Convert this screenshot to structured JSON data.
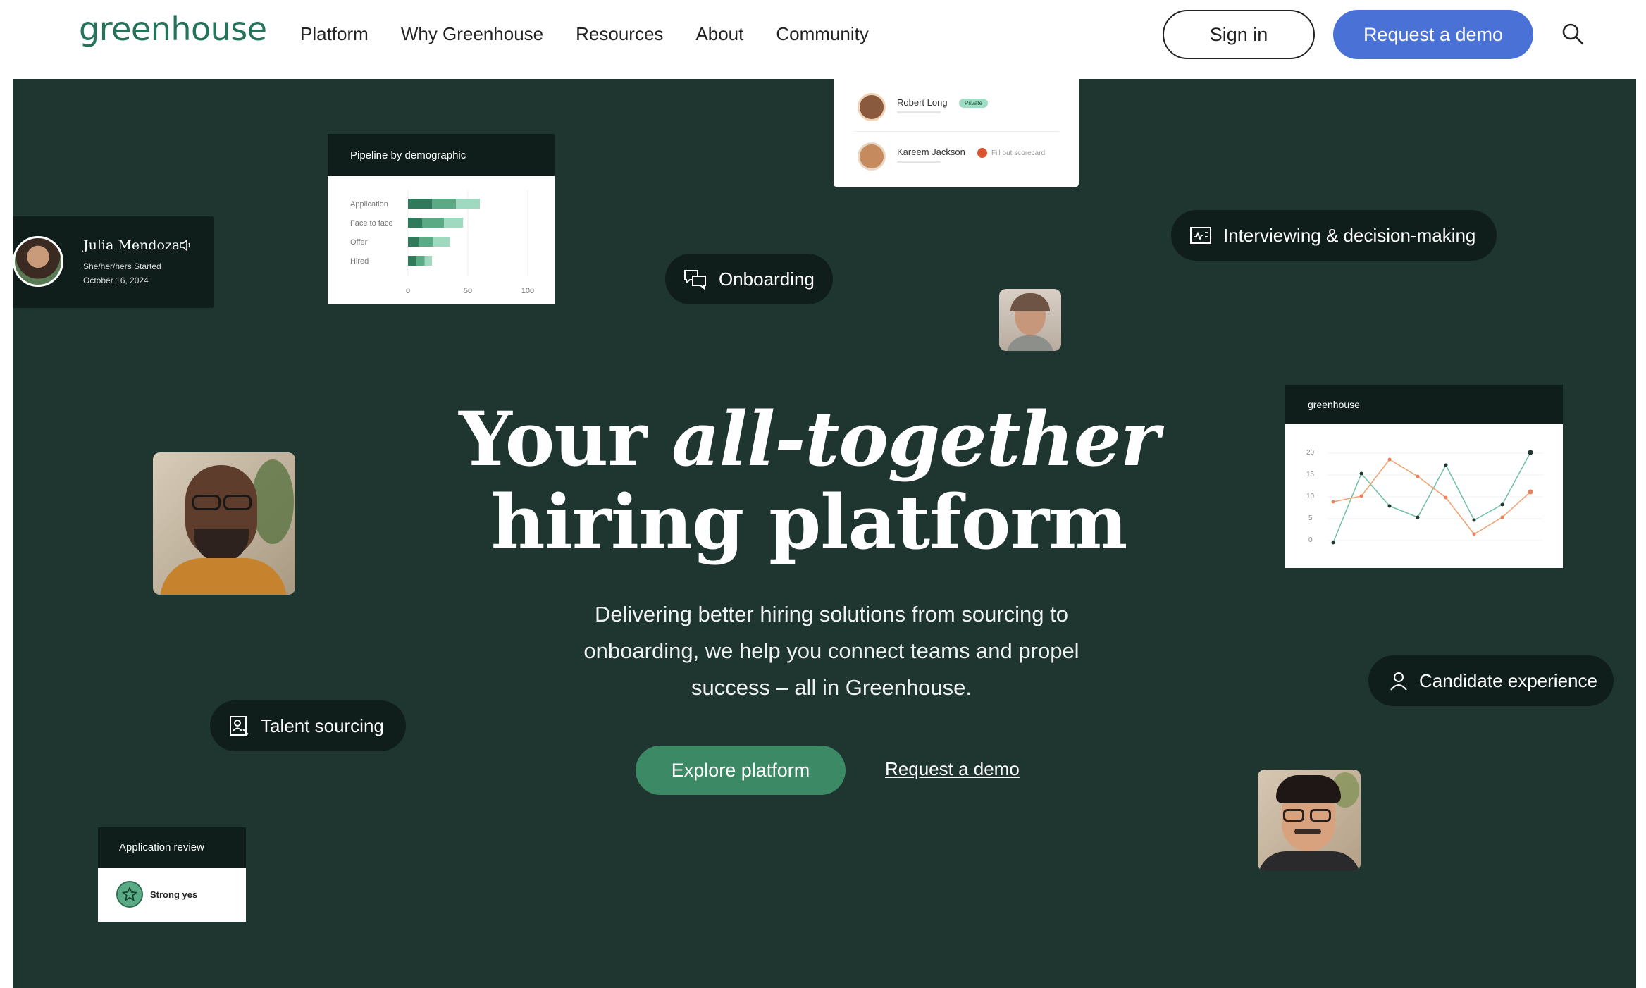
{
  "nav": {
    "logo": "greenhouse",
    "links": [
      "Platform",
      "Why Greenhouse",
      "Resources",
      "About",
      "Community"
    ],
    "signin": "Sign in",
    "request_demo": "Request a demo"
  },
  "hero": {
    "title_line1_plain": "Your ",
    "title_line1_italic": "all-together",
    "title_line2": "hiring platform",
    "subtitle": "Delivering better hiring solutions from sourcing to onboarding, we help you connect teams and propel success – all in Greenhouse.",
    "primary_cta": "Explore platform",
    "secondary_cta": "Request a demo"
  },
  "cards": {
    "profile": {
      "name": "Julia Mendoza",
      "pronouns_line": "She/her/hers  Started",
      "date_line": "October 16, 2024"
    },
    "pipeline": {
      "title": "Pipeline by demographic",
      "rows": [
        "Application",
        "Face to face",
        "Offer",
        "Hired"
      ],
      "ticks": [
        "0",
        "50",
        "100"
      ],
      "bars": [
        [
          20,
          20,
          20
        ],
        [
          12,
          18,
          16
        ],
        [
          9,
          12,
          14
        ],
        [
          7,
          7,
          6
        ]
      ]
    },
    "interviewers": [
      {
        "name": "Robert Long",
        "badge": "Private"
      },
      {
        "name": "Kareem Jackson",
        "status": "Fill out scorecard"
      }
    ],
    "review": {
      "title": "Application review",
      "value": "Strong yes"
    },
    "linechart": {
      "brand": "greenhouse",
      "y_ticks": [
        "20",
        "15",
        "10",
        "5",
        "0"
      ]
    }
  },
  "chips": {
    "onboarding": "Onboarding",
    "interviewing": "Interviewing & decision-making",
    "talent": "Talent sourcing",
    "candidate": "Candidate experience"
  },
  "colors": {
    "hero_bg": "#1f3530",
    "brand_green": "#24735a",
    "demo_blue": "#4a72d6",
    "cta_green": "#3b8a65"
  }
}
